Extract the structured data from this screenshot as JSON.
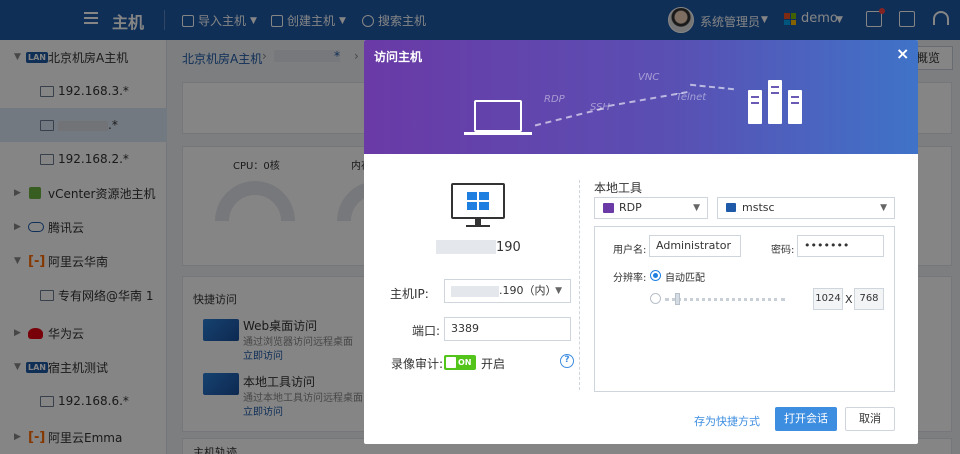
{
  "topbar": {
    "title": "主机",
    "actions": [
      {
        "label": "导入主机",
        "icon": "import-icon"
      },
      {
        "label": "创建主机",
        "icon": "create-icon"
      },
      {
        "label": "搜索主机",
        "icon": "search-icon"
      }
    ],
    "user": "系统管理员",
    "tenant": "demo",
    "icons": [
      "mail-icon",
      "task-icon",
      "headset-icon"
    ]
  },
  "sidebar": {
    "items": [
      {
        "label": "北京机房A主机",
        "type": "lan"
      },
      {
        "label": "192.168.3.*",
        "type": "host"
      },
      {
        "label": ".*",
        "type": "host-masked"
      },
      {
        "label": "192.168.2.*",
        "type": "host"
      },
      {
        "label": "vCenter资源池主机",
        "type": "vcenter"
      },
      {
        "label": "腾讯云",
        "type": "cloud"
      },
      {
        "label": "阿里云华南",
        "type": "aliyun"
      },
      {
        "label": "专有网络@华南 1",
        "type": "vpc"
      },
      {
        "label": "华为云",
        "type": "huawei"
      },
      {
        "label": "宿主机测试",
        "type": "lan"
      },
      {
        "label": "192.168.6.*",
        "type": "host"
      },
      {
        "label": "阿里云Emma",
        "type": "aliyun"
      }
    ]
  },
  "main": {
    "breadcrumb_root": "北京机房A主机",
    "overview_btn": "概览",
    "cpu_label": "CPU：0核",
    "mem_label": "内存",
    "quick_title": "快捷访问",
    "quick": [
      {
        "title": "Web桌面访问",
        "desc": "通过浏览器访问远程桌面",
        "link": "立即访问"
      },
      {
        "title": "本地工具访问",
        "desc": "通过本地工具访问远程桌面",
        "link": "立即访问"
      }
    ],
    "track_title": "主机轨迹"
  },
  "modal": {
    "title": "访问主机",
    "close": "×",
    "protocols": [
      "RDP",
      "SSH",
      "VNC",
      "Telnet"
    ],
    "host_ip_suffix": "190",
    "host_ip_label": "主机IP:",
    "host_ip_value": ".190（内）",
    "port_label": "端口:",
    "port_value": "3389",
    "record_label": "录像审计:",
    "record_toggle": "ON",
    "record_state": "开启",
    "help": "?",
    "local_tool_title": "本地工具",
    "protocol_selected": "RDP",
    "client_selected": "mstsc",
    "username_label": "用户名:",
    "username_value": "Administrator",
    "password_label": "密码:",
    "password_value": "•••••••",
    "resolution_label": "分辨率:",
    "auto_match": "自动匹配",
    "res_width": "1024",
    "res_x": "X",
    "res_height": "768",
    "save_shortcut": "存为快捷方式",
    "open_session": "打开会话",
    "cancel": "取消"
  },
  "colors": {
    "topbar": "#1f5aa8",
    "banner_start": "#6a3aa6",
    "banner_end": "#3f73c8",
    "primary_button": "#3d8de0",
    "toggle_on": "#52c41a"
  }
}
